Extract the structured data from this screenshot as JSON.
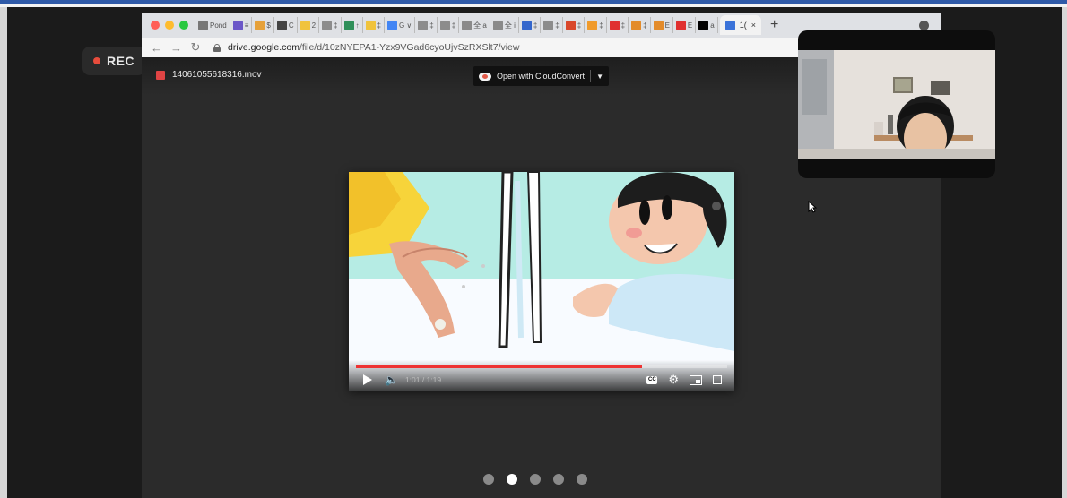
{
  "recording": {
    "label": "REC"
  },
  "browser": {
    "tab_labels": [
      "Pond",
      "≡",
      "$",
      "C",
      "2",
      "‡",
      "↑",
      "‡",
      "G ∨",
      "‡",
      "‡",
      "全 a",
      "全 i",
      "‡",
      "‡",
      "‡",
      "‡",
      "‡",
      "‡",
      "E",
      "E",
      "a"
    ],
    "active_tab": {
      "label": "1(",
      "close": "×"
    },
    "new_tab": "+",
    "address": {
      "host": "drive.google.com",
      "path": "/file/d/10zNYEPA1-Yzx9VGad6cyoUjvSzRXSlt7/view"
    }
  },
  "drive": {
    "file_name": "14061055618316.mov",
    "open_with_label": "Open with CloudConvert"
  },
  "video": {
    "current_time": "1:01",
    "duration": "1:19",
    "time_display": "1:01 / 1:19",
    "progress_fraction": 0.77,
    "cc_label": "CC"
  },
  "pagination": {
    "count": 5,
    "active_index": 1
  },
  "colors": {
    "rec_dot": "#e74c3c",
    "progress": "#e33333",
    "frame_accent": "#2f5aa8"
  },
  "icons": [
    "back-icon",
    "forward-icon",
    "reload-icon",
    "lock-icon",
    "play-icon",
    "volume-icon",
    "cc-icon",
    "settings-icon",
    "miniplayer-icon",
    "fullscreen-icon",
    "cursor-icon"
  ]
}
